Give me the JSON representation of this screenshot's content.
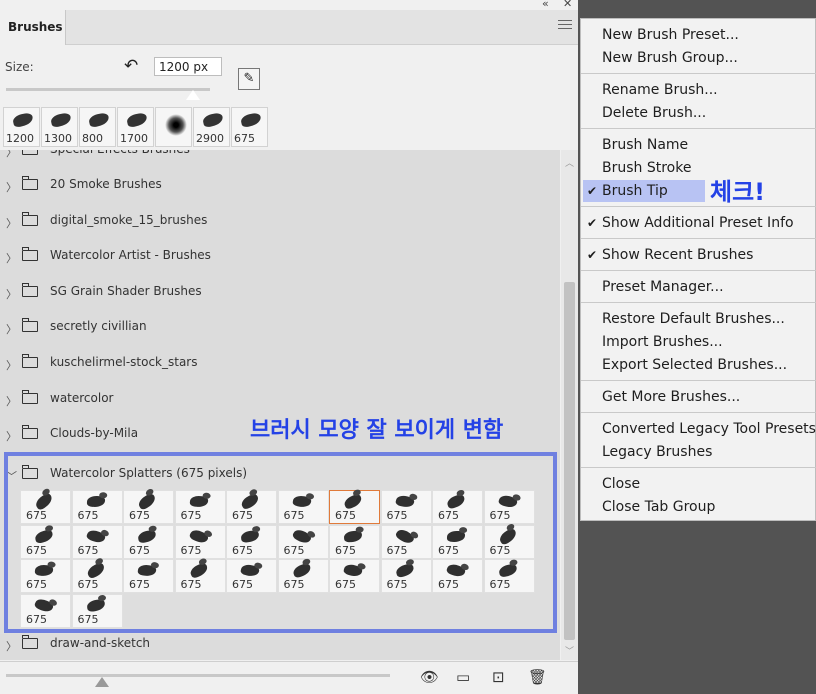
{
  "panel": {
    "tab_label": "Brushes",
    "size_label": "Size:",
    "size_value": "1200 px",
    "recent_sizes": [
      "1200",
      "1300",
      "800",
      "1700",
      "",
      "2900",
      "675"
    ]
  },
  "folders_top": [
    "Special Effects Brushes",
    "20 Smoke Brushes",
    "digital_smoke_15_brushes",
    "Watercolor Artist - Brushes",
    "SG Grain Shader Brushes",
    "secretly civillian",
    "kuschelirmel-stock_stars",
    "watercolor",
    "Clouds-by-Mila"
  ],
  "expanded_folder": {
    "name": "Watercolor Splatters (675 pixels)",
    "brush_sizes": [
      "675",
      "675",
      "675",
      "675",
      "675",
      "675",
      "675",
      "675",
      "675",
      "675",
      "675",
      "675",
      "675",
      "675",
      "675",
      "675",
      "675",
      "675",
      "675",
      "675",
      "675",
      "675",
      "675",
      "675",
      "675",
      "675",
      "675",
      "675",
      "675",
      "675",
      "675",
      "675"
    ],
    "selected_index": 6
  },
  "folder_after": "draw-and-sketch",
  "annotations": {
    "shape_note": "브러시 모양 잘 보이게 변함",
    "check_note": "체크!"
  },
  "menu": {
    "groups": [
      [
        {
          "label": "New Brush Preset...",
          "checked": false
        },
        {
          "label": "New Brush Group...",
          "checked": false
        }
      ],
      [
        {
          "label": "Rename Brush...",
          "checked": false
        },
        {
          "label": "Delete Brush...",
          "checked": false
        }
      ],
      [
        {
          "label": "Brush Name",
          "checked": false
        },
        {
          "label": "Brush Stroke",
          "checked": false
        },
        {
          "label": "Brush Tip",
          "checked": true,
          "highlighted": true
        }
      ],
      [
        {
          "label": "Show Additional Preset Info",
          "checked": true
        }
      ],
      [
        {
          "label": "Show Recent Brushes",
          "checked": true
        }
      ],
      [
        {
          "label": "Preset Manager...",
          "checked": false
        }
      ],
      [
        {
          "label": "Restore Default Brushes...",
          "checked": false
        },
        {
          "label": "Import Brushes...",
          "checked": false
        },
        {
          "label": "Export Selected Brushes...",
          "checked": false
        }
      ],
      [
        {
          "label": "Get More Brushes...",
          "checked": false
        }
      ],
      [
        {
          "label": "Converted Legacy Tool Presets",
          "checked": false
        },
        {
          "label": "Legacy Brushes",
          "checked": false
        }
      ],
      [
        {
          "label": "Close",
          "checked": false
        },
        {
          "label": "Close Tab Group",
          "checked": false
        }
      ]
    ]
  },
  "icons": {
    "check": "✔",
    "chevron_right": "〉",
    "chevron_down": "﹀",
    "collapse": "«",
    "close": "✕",
    "reset": "↶"
  },
  "colors": {
    "annotation_blue": "#2442e6",
    "highlight_box": "#6f80e0",
    "menu_highlight": "#b8c3f3",
    "selected_brush_border": "#e07a3a"
  }
}
